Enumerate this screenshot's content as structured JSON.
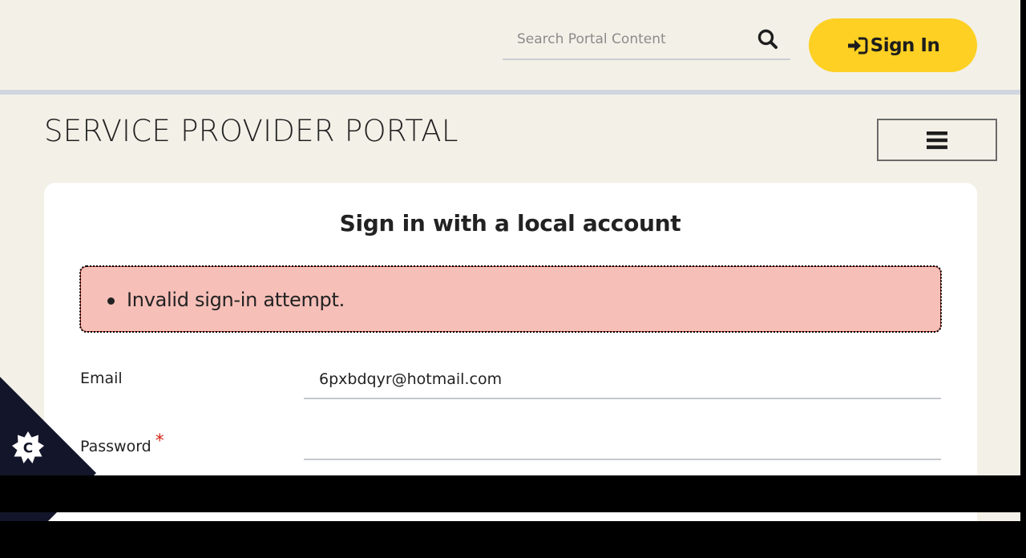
{
  "header": {
    "search": {
      "placeholder": "Search Portal Content",
      "value": "",
      "icon": "search-icon"
    },
    "signin": {
      "label": "Sign In",
      "icon": "sign-in-icon"
    }
  },
  "portal": {
    "title": "SERVICE PROVIDER PORTAL",
    "menu_icon": "hamburger-menu-icon"
  },
  "login_card": {
    "title": "Sign in with a local account",
    "errors": [
      "Invalid sign-in attempt."
    ],
    "fields": {
      "email": {
        "label": "Email",
        "value": "6pxbdqyr@hotmail.com",
        "required": false
      },
      "password": {
        "label": "Password",
        "value": "",
        "required": true,
        "required_marker": "*"
      }
    }
  },
  "cookie_widget": {
    "icon": "cookie-settings-icon",
    "letter": "C"
  },
  "colors": {
    "background": "#f3f0e7",
    "accent_yellow": "#fdd023",
    "error_bg": "#f6bfb8",
    "error_border": "#b02a1f",
    "required_red": "#d2281a",
    "cookie_dark": "#13162a"
  }
}
